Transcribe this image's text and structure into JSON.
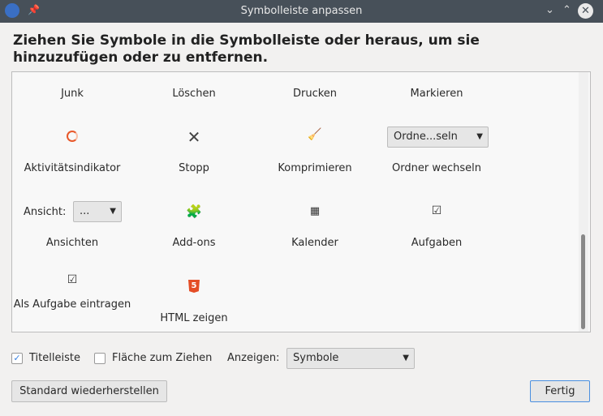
{
  "window": {
    "title": "Symbolleiste anpassen"
  },
  "heading": "Ziehen Sie Symbole in die Symbolleiste oder heraus, um sie hinzuzufügen oder zu entfernen.",
  "palette": {
    "row1": [
      "Junk",
      "Löschen",
      "Drucken",
      "Markieren"
    ],
    "row2": [
      "Aktivitätsindikator",
      "Stopp",
      "Komprimieren",
      "Ordner wechseln"
    ],
    "folder_select": "Ordne...seln",
    "view_label": "Ansicht:",
    "view_select": "...",
    "row3": [
      "Ansichten",
      "Add-ons",
      "Kalender",
      "Aufgaben"
    ],
    "row4": [
      "Als Aufgabe eintragen",
      "HTML zeigen"
    ]
  },
  "footer": {
    "titlebar_label": "Titelleiste",
    "titlebar_checked": true,
    "drag_label": "Fläche zum Ziehen",
    "drag_checked": false,
    "show_label": "Anzeigen:",
    "show_value": "Symbole",
    "restore_label": "Standard wiederherstellen",
    "done_label": "Fertig"
  }
}
